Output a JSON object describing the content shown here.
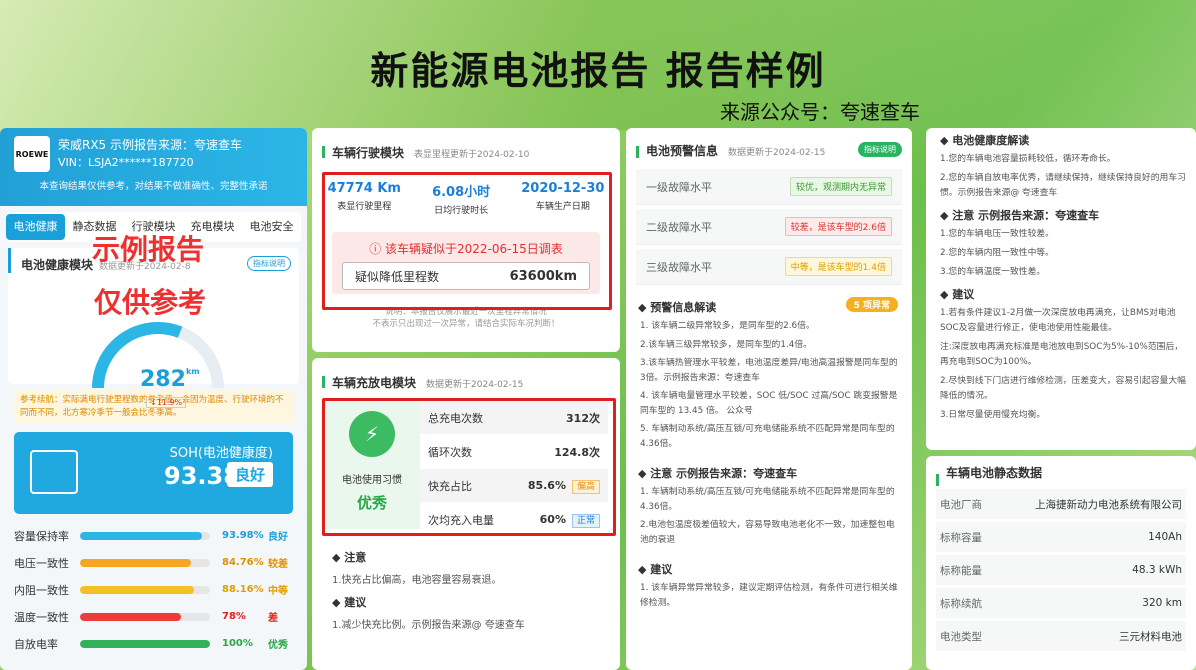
{
  "header": {
    "title": "新能源电池报告 报告样例",
    "source": "来源公众号：夸速查车"
  },
  "car": {
    "logo": "ROEWE",
    "name": "荣威RX5 示例报告来源：夸速查车",
    "vin": "VIN：LSJA2******187720",
    "note": "本查询结果仅供参考，对结果不做准确性、完整性承诺"
  },
  "tabs": [
    "电池健康",
    "静态数据",
    "行驶模块",
    "充电模块",
    "电池安全"
  ],
  "watermark": {
    "line1": "示例报告",
    "line2": "仅供参考"
  },
  "health": {
    "title": "电池健康模块",
    "updated": "数据更新于2024-02-8",
    "badge": "指标说明",
    "gauge_value": "282",
    "gauge_unit": "km",
    "gauge_drop": "↓11.9%",
    "gauge_fraction": 0.62,
    "tip": "参考续航：实际满电行驶里程数的参考值，会因为温度、行驶环境的不同而不同，北方寒冷季节一般会比冬季高。"
  },
  "soh": {
    "label": "SOH(电池健康度)",
    "value": "93.38",
    "unit": "%",
    "grade": "良好"
  },
  "metrics": [
    {
      "label": "容量保持率",
      "value": "93.98%",
      "grade": "良好",
      "fraction": 0.94,
      "color": "#2bb6e6",
      "gcolor": "#1aa0d8"
    },
    {
      "label": "电压一致性",
      "value": "84.76%",
      "grade": "较差",
      "fraction": 0.85,
      "color": "#f5a623",
      "gcolor": "#e09000"
    },
    {
      "label": "内阻一致性",
      "value": "88.16%",
      "grade": "中等",
      "fraction": 0.88,
      "color": "#f5c023",
      "gcolor": "#e0a000"
    },
    {
      "label": "温度一致性",
      "value": "78%",
      "grade": "差",
      "fraction": 0.78,
      "color": "#ee3b3b",
      "gcolor": "#e02020"
    },
    {
      "label": "自放电率",
      "value": "100%",
      "grade": "优秀",
      "fraction": 1.0,
      "color": "#33b05a",
      "gcolor": "#28a745"
    }
  ],
  "drive": {
    "title": "车辆行驶模块",
    "updated": "表显里程更新于2024-02-10",
    "mileage": "47774 Km",
    "mileage_label": "表显行驶里程",
    "hours": "6.08小时",
    "hours_label": "日均行驶时长",
    "date": "2020-12-30",
    "date_label": "车辆生产日期",
    "alert": "该车辆疑似于2022-06-15日调表",
    "reduced_label": "疑似降低里程数",
    "reduced_value": "63600km",
    "explain1": "说明：本报告仅展示最近一次里程异常情况",
    "explain2": "不表示只出现过一次异常，请结合实际车况判断！"
  },
  "charge": {
    "title": "车辆充放电模块",
    "updated": "数据更新于2024-02-15",
    "habit_label": "电池使用习惯",
    "habit_value": "优秀",
    "rows": [
      {
        "label": "总充电次数",
        "value": "312次",
        "tag": ""
      },
      {
        "label": "循环次数",
        "value": "124.8次",
        "tag": ""
      },
      {
        "label": "快充占比",
        "value": "85.6%",
        "tag": "偏高"
      },
      {
        "label": "次均充入电量",
        "value": "60%",
        "tag": "正常"
      }
    ],
    "note_title": "注意",
    "note_text": "1.快充占比偏高，电池容量容易衰退。",
    "advice_title": "建议",
    "advice_text": "1.减少快充比例。示例报告来源@ 夸速查车"
  },
  "warning": {
    "title": "电池预警信息",
    "updated": "数据更新于2024-02-15",
    "badge": "指标说明",
    "levels": [
      {
        "label": "一级故障水平",
        "tag": "较优，观测期内无异常"
      },
      {
        "label": "二级故障水平",
        "tag": "较差，是该车型的2.6倍"
      },
      {
        "label": "三级故障水平",
        "tag": "中等，是该车型的1.4倍"
      }
    ],
    "interp_title": "预警信息解读",
    "interp_badge": "5 项异常",
    "interp": [
      "1. 该车辆二级异常较多，是同车型的2.6倍。",
      "2.该车辆三级异常较多，是同车型的1.4倍。",
      "3.该车辆热管理水平较差，电池温度差异/电池高温报警是同车型的3倍。示例报告来源：夸速查车",
      "4. 该车辆电量管理水平较差，SOC 低/SOC 过高/SOC 跳变报警是同车型的 13.45 倍。 公众号",
      "5. 车辆制动系统/高压互锁/可充电储能系统不匹配异常是同车型的4.36倍。"
    ],
    "note_title": "注意 示例报告来源：夸速查车",
    "note": [
      "1. 车辆制动系统/高压互锁/可充电储能系统不匹配异常是同车型的4.36倍。",
      "2.电池包温度极差值较大，容易导致电池老化不一致，加速整包电池的衰退"
    ],
    "advice_title": "建议",
    "advice": [
      "1. 该车辆异常异常较多，建议定期评估检测，有条件可进行相关维修检测。"
    ]
  },
  "interpret": {
    "title": "电池健康度解读",
    "lines": [
      "1.您的车辆电池容量损耗较低，循环寿命长。",
      "2.您的车辆自放电率优秀，请继续保持，继续保持良好的用车习惯。示例报告来源@ 夸速查车"
    ],
    "note_title": "注意 示例报告来源：夸速查车",
    "notes": [
      "1.您的车辆电压一致性较差。",
      "2.您的车辆内阻一致性中等。",
      "3.您的车辆温度一致性差。"
    ],
    "advice_title": "建议",
    "advice": [
      "1.若有条件建议1-2月做一次深度放电再满充，让BMS对电池SOC及容量进行修正，使电池使用性能最佳。",
      "注:深度放电再满充标准是电池放电到SOC为5%-10%范围后，再充电到SOC为100%。",
      "2.尽快到线下门店进行维修检测，压差变大，容易引起容量大幅降低的情况。",
      "3.日常尽量使用慢充均衡。"
    ]
  },
  "static": {
    "title": "车辆电池静态数据",
    "rows": [
      {
        "k": "电池厂商",
        "v": "上海捷新动力电池系统有限公司"
      },
      {
        "k": "标称容量",
        "v": "140Ah"
      },
      {
        "k": "标称能量",
        "v": "48.3 kWh"
      },
      {
        "k": "标称续航",
        "v": "320 km"
      },
      {
        "k": "电池类型",
        "v": "三元材料电池"
      }
    ]
  }
}
